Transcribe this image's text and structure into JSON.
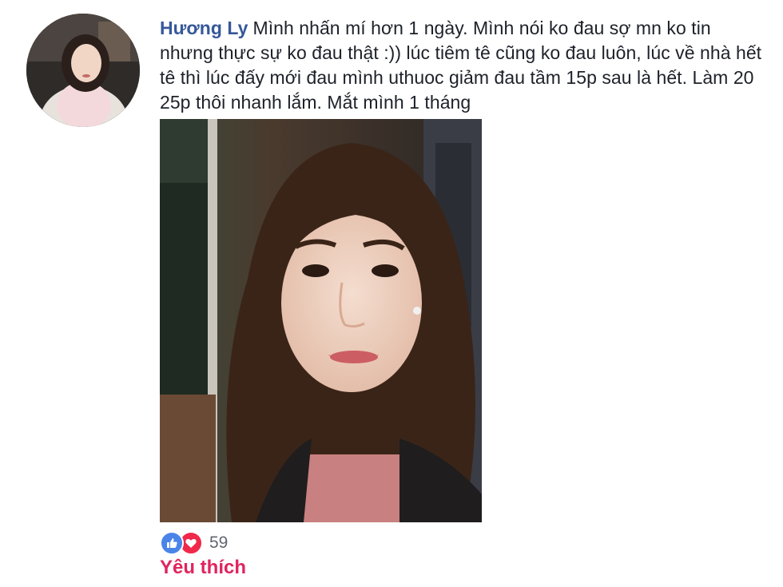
{
  "comment": {
    "author": "Hương Ly",
    "text": "Mình nhấn mí hơn 1 ngày. Mình nói ko đau sợ mn ko tin nhưng thực sự ko đau thật :)) lúc tiêm tê cũng ko đau luôn, lúc về nhà hết tê thì lúc đấy mới đau mình uthuoc giảm đau tầm 15p sau là hết. Làm 20 25p thôi nhanh lắm. Mắt mình 1 tháng"
  },
  "reactions": {
    "icons": [
      "like-icon",
      "love-icon"
    ],
    "count": "59"
  },
  "action": {
    "label": "Yêu thích"
  },
  "colors": {
    "author_link": "#365899",
    "like": "#4a84e8",
    "love": "#f0284a",
    "action_active": "#e0245e"
  }
}
